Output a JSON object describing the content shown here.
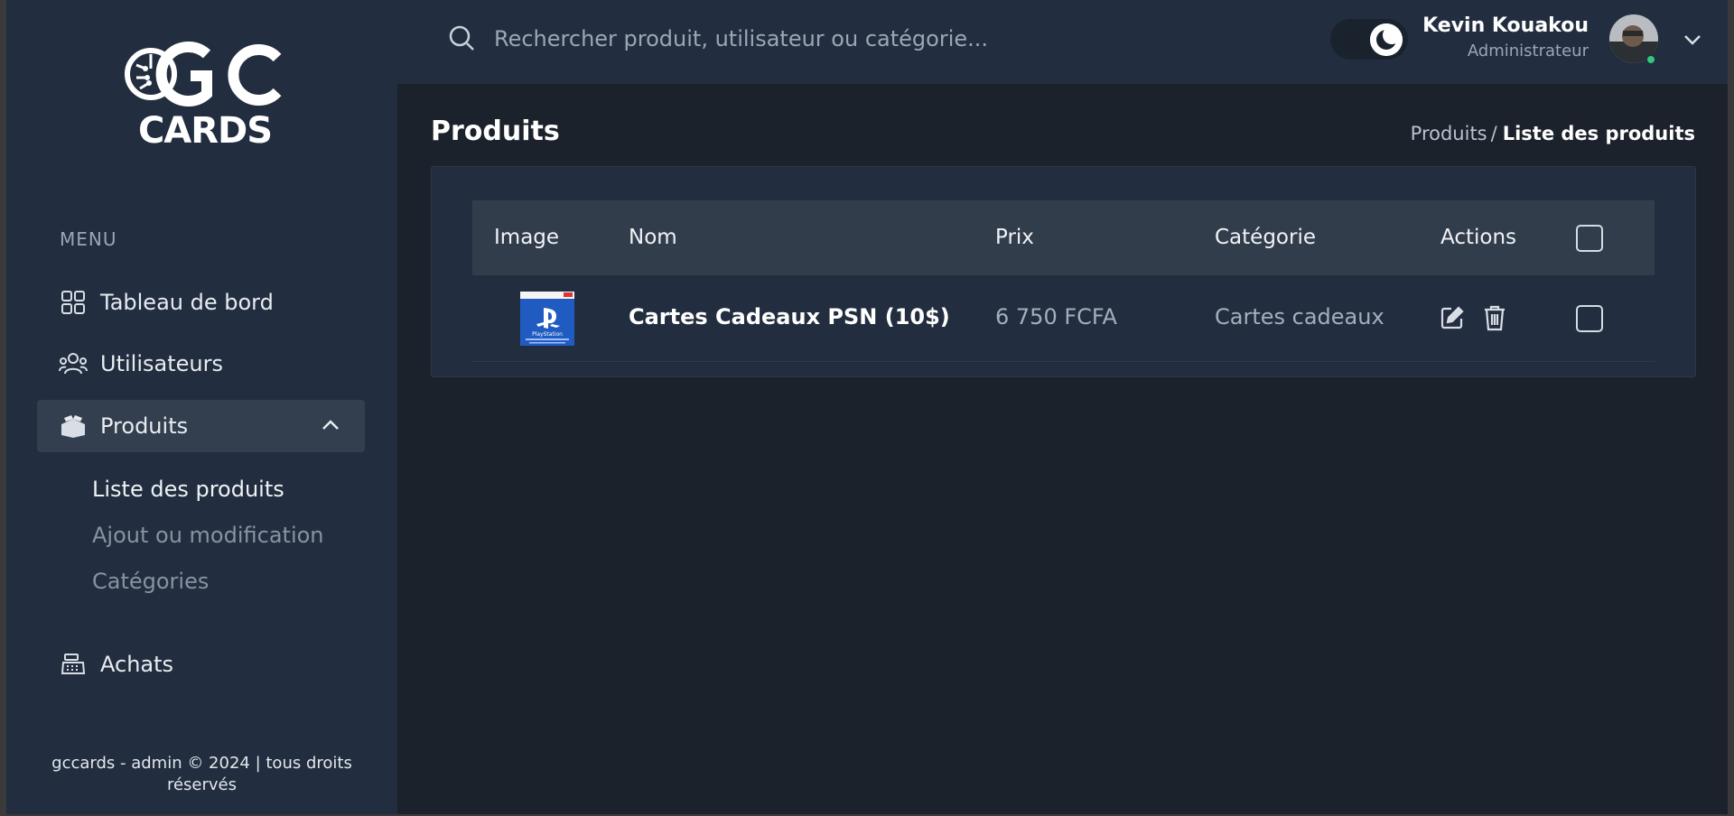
{
  "app": {
    "logo_text": "GC CARDS"
  },
  "sidebar": {
    "menu_title": "MENU",
    "items": [
      {
        "label": "Tableau de bord",
        "icon": "grid-icon"
      },
      {
        "label": "Utilisateurs",
        "icon": "users-icon"
      },
      {
        "label": "Produits",
        "icon": "boxes-icon",
        "expanded": true
      },
      {
        "label": "Achats",
        "icon": "cash-register-icon"
      }
    ],
    "sub_items": [
      {
        "label": "Liste des produits",
        "current": true
      },
      {
        "label": "Ajout ou modification",
        "current": false
      },
      {
        "label": "Catégories",
        "current": false
      }
    ],
    "footer": "gccards - admin © 2024 | tous droits réservés"
  },
  "topbar": {
    "search_placeholder": "Rechercher produit, utilisateur ou catégorie...",
    "theme_toggle": "dark-mode",
    "user": {
      "name": "Kevin Kouakou",
      "role": "Administrateur",
      "online": true
    }
  },
  "page": {
    "title": "Produits",
    "breadcrumb": {
      "parent": "Produits",
      "separator": "/",
      "current": "Liste des produits"
    }
  },
  "table": {
    "headers": [
      "Image",
      "Nom",
      "Prix",
      "Catégorie",
      "Actions"
    ],
    "rows": [
      {
        "thumbnail": "PlayStation",
        "name": "Cartes Cadeaux PSN (10$)",
        "price": "6 750 FCFA",
        "category": "Cartes cadeaux"
      }
    ]
  },
  "colors": {
    "sidebar_bg": "#222e3f",
    "content_bg": "#1c222b",
    "header_row_bg": "#323d4c",
    "accent_online": "#34c77b"
  }
}
